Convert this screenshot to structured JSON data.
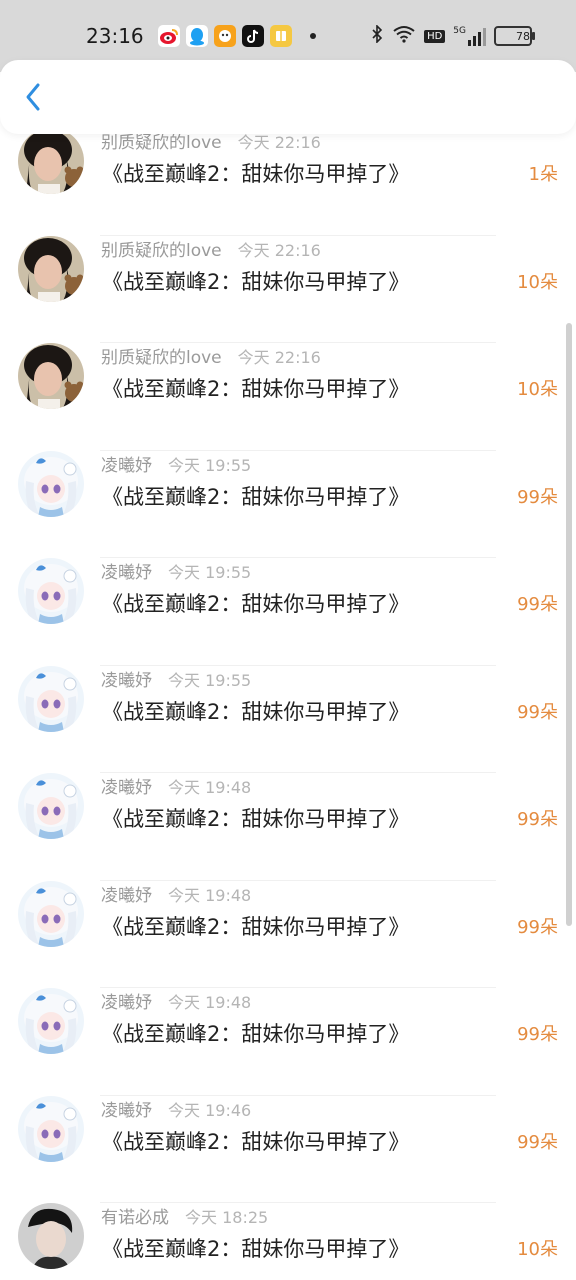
{
  "status_bar": {
    "time": "23:16",
    "battery": "78",
    "network": "5G",
    "hd_label": "HD",
    "app_icons": [
      "weibo-icon",
      "qq-icon",
      "taobao-icon",
      "tiktok-icon",
      "reader-icon"
    ]
  },
  "list": {
    "items": [
      {
        "user": "别质疑欣的love",
        "time": "今天 22:16",
        "title": "《战至巅峰2：甜妹你马甲掉了》",
        "amount": "1朵",
        "avatar": "girl"
      },
      {
        "user": "别质疑欣的love",
        "time": "今天 22:16",
        "title": "《战至巅峰2：甜妹你马甲掉了》",
        "amount": "10朵",
        "avatar": "girl"
      },
      {
        "user": "别质疑欣的love",
        "time": "今天 22:16",
        "title": "《战至巅峰2：甜妹你马甲掉了》",
        "amount": "10朵",
        "avatar": "girl"
      },
      {
        "user": "凌曦妤",
        "time": "今天 19:55",
        "title": "《战至巅峰2：甜妹你马甲掉了》",
        "amount": "99朵",
        "avatar": "anime"
      },
      {
        "user": "凌曦妤",
        "time": "今天 19:55",
        "title": "《战至巅峰2：甜妹你马甲掉了》",
        "amount": "99朵",
        "avatar": "anime"
      },
      {
        "user": "凌曦妤",
        "time": "今天 19:55",
        "title": "《战至巅峰2：甜妹你马甲掉了》",
        "amount": "99朵",
        "avatar": "anime"
      },
      {
        "user": "凌曦妤",
        "time": "今天 19:48",
        "title": "《战至巅峰2：甜妹你马甲掉了》",
        "amount": "99朵",
        "avatar": "anime"
      },
      {
        "user": "凌曦妤",
        "time": "今天 19:48",
        "title": "《战至巅峰2：甜妹你马甲掉了》",
        "amount": "99朵",
        "avatar": "anime"
      },
      {
        "user": "凌曦妤",
        "time": "今天 19:48",
        "title": "《战至巅峰2：甜妹你马甲掉了》",
        "amount": "99朵",
        "avatar": "anime"
      },
      {
        "user": "凌曦妤",
        "time": "今天 19:46",
        "title": "《战至巅峰2：甜妹你马甲掉了》",
        "amount": "99朵",
        "avatar": "anime"
      },
      {
        "user": "有诺必成",
        "time": "今天 18:25",
        "title": "《战至巅峰2：甜妹你马甲掉了》",
        "amount": "10朵",
        "avatar": "boy"
      }
    ]
  },
  "colors": {
    "amount": "#e48b3f",
    "back_icon": "#2f8ee0"
  }
}
